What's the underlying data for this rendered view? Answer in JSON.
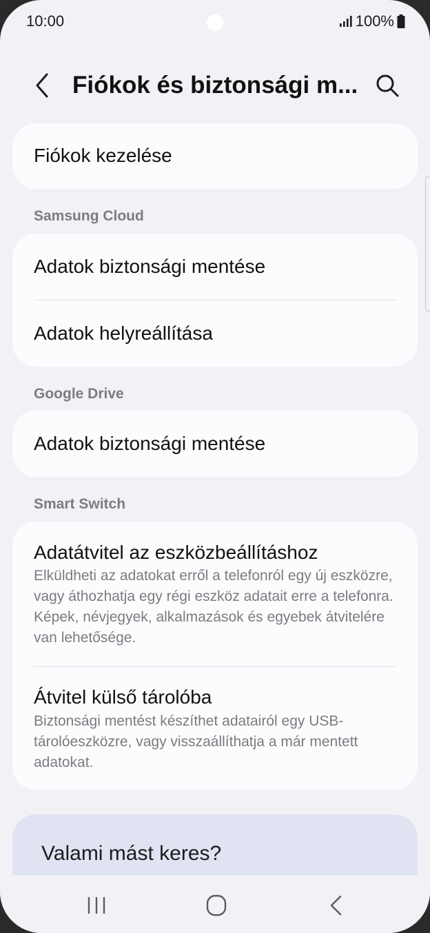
{
  "status_bar": {
    "time": "10:00",
    "battery_text": "100%",
    "icons": [
      "signal-icon",
      "battery-icon",
      "camera-dot"
    ]
  },
  "header": {
    "title": "Fiókok és biztonsági m...",
    "back_icon": "chevron-left-icon",
    "search_icon": "search-icon"
  },
  "sections": {
    "accounts": {
      "item": "Fiókok kezelése"
    },
    "samsung_cloud": {
      "header": "Samsung Cloud",
      "items": [
        "Adatok biztonsági mentése",
        "Adatok helyreállítása"
      ]
    },
    "google_drive": {
      "header": "Google Drive",
      "items": [
        "Adatok biztonsági mentése"
      ]
    },
    "smart_switch": {
      "header": "Smart Switch",
      "items": [
        {
          "title": "Adatátvitel az eszközbeállításhoz",
          "description": "Elküldheti az adatokat erről a telefonról egy új eszközre, vagy áthozhatja egy régi eszköz adatait erre a telefonra. Képek, névjegyek, alkalmazások és egyebek átvitelére van lehetősége."
        },
        {
          "title": "Átvitel külső tárolóba",
          "description": "Biztonsági mentést készíthet adatairól egy USB-tárolóeszközre, vagy visszaállíthatja a már mentett adatokat."
        }
      ]
    }
  },
  "suggestion": {
    "title": "Valami mást keres?"
  },
  "nav_bar": {
    "buttons": [
      "recent-apps-icon",
      "home-icon",
      "back-icon"
    ]
  },
  "colors": {
    "background": "#f2f1f6",
    "card": "#fcfcfe",
    "section_header": "#7b7b80",
    "suggestion_card": "#dfe3f2"
  }
}
